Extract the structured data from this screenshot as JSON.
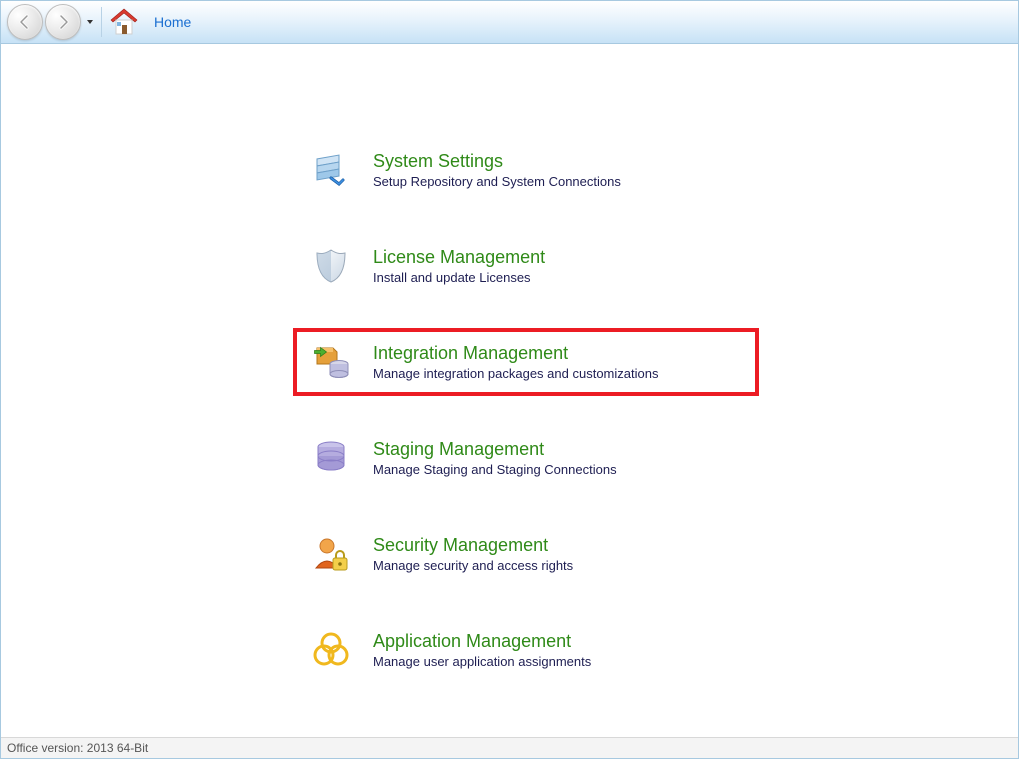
{
  "toolbar": {
    "breadcrumb": "Home"
  },
  "menu": {
    "items": [
      {
        "title": "System Settings",
        "desc": "Setup Repository and System Connections"
      },
      {
        "title": "License Management",
        "desc": "Install and update Licenses"
      },
      {
        "title": "Integration Management",
        "desc": "Manage integration packages and customizations"
      },
      {
        "title": "Staging Management",
        "desc": "Manage Staging and Staging Connections"
      },
      {
        "title": "Security Management",
        "desc": "Manage security and access rights"
      },
      {
        "title": "Application Management",
        "desc": "Manage user application assignments"
      }
    ],
    "highlighted_index": 2
  },
  "statusbar": {
    "office_version": "Office version: 2013 64-Bit"
  }
}
